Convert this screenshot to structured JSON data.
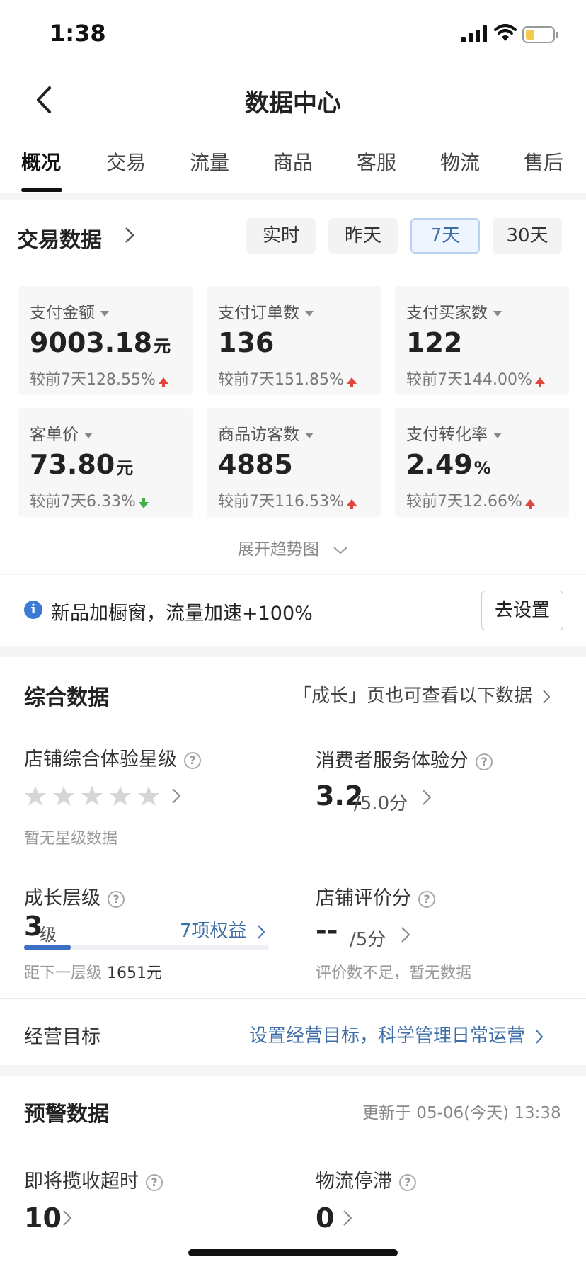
{
  "status_bar": {
    "time": "1:38"
  },
  "nav": {
    "title": "数据中心"
  },
  "tabs": [
    {
      "label": "概况",
      "active": true
    },
    {
      "label": "交易",
      "active": false
    },
    {
      "label": "流量",
      "active": false
    },
    {
      "label": "商品",
      "active": false
    },
    {
      "label": "客服",
      "active": false
    },
    {
      "label": "物流",
      "active": false
    },
    {
      "label": "售后",
      "active": false
    }
  ],
  "trade": {
    "title": "交易数据",
    "periods": [
      "实时",
      "昨天",
      "7天",
      "30天"
    ],
    "selected_period": "7天",
    "cards": [
      {
        "label": "支付金额",
        "value": "9003.18",
        "unit": "元",
        "compare": "较前7天128.55%",
        "trend": "up"
      },
      {
        "label": "支付订单数",
        "value": "136",
        "unit": "",
        "compare": "较前7天151.85%",
        "trend": "up"
      },
      {
        "label": "支付买家数",
        "value": "122",
        "unit": "",
        "compare": "较前7天144.00%",
        "trend": "up"
      },
      {
        "label": "客单价",
        "value": "73.80",
        "unit": "元",
        "compare": "较前7天6.33%",
        "trend": "down"
      },
      {
        "label": "商品访客数",
        "value": "4885",
        "unit": "",
        "compare": "较前7天116.53%",
        "trend": "up"
      },
      {
        "label": "支付转化率",
        "value": "2.49",
        "unit": "%",
        "compare": "较前7天12.66%",
        "trend": "up"
      }
    ],
    "expand_label": "展开趋势图"
  },
  "promo": {
    "text": "新品加橱窗，流量加速+100%",
    "button": "去设置",
    "info_icon": "i"
  },
  "overall": {
    "title": "综合数据",
    "link": "「成长」页也可查看以下数据",
    "store_rating_label": "店铺综合体验星级",
    "store_rating_stars": 0,
    "store_rating_note": "暂无星级数据",
    "consumer_score_label": "消费者服务体验分",
    "consumer_score_value": "3.2",
    "consumer_score_suffix": "/5.0分",
    "growth_label": "成长层级",
    "growth_level": "3",
    "growth_level_unit": "级",
    "growth_benefits": "7项权益",
    "growth_progress": 0.19,
    "growth_note_prefix": "距下一层级",
    "growth_note_value": "1651元",
    "review_label": "店铺评价分",
    "review_value": "--",
    "review_suffix": "/5分",
    "review_note": "评价数不足，暂无数据",
    "goal_label": "经营目标",
    "goal_link": "设置经营目标，科学管理日常运营"
  },
  "warning": {
    "title": "预警数据",
    "updated": "更新于 05-06(今天) 13:38",
    "pickup_label": "即将揽收超时",
    "pickup_value": "10",
    "logistics_label": "物流停滞",
    "logistics_value": "0"
  },
  "help_glyph": "?",
  "colors": {
    "accent": "#3d6ea7",
    "up": "#e0463a",
    "down": "#3eb04a"
  }
}
